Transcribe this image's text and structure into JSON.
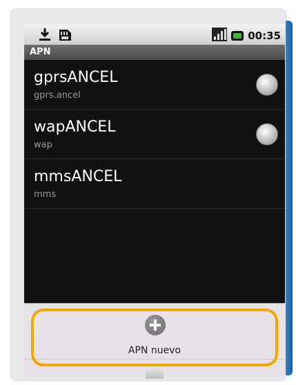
{
  "status_bar": {
    "time": "00:35",
    "icons": [
      "download-icon",
      "sd-card-icon",
      "signal-icon",
      "battery-icon"
    ]
  },
  "title_bar": {
    "title": "APN"
  },
  "apn_list": [
    {
      "name": "gprsANCEL",
      "apn": "gprs.ancel",
      "selectable": true
    },
    {
      "name": "wapANCEL",
      "apn": "wap",
      "selectable": true
    },
    {
      "name": "mmsANCEL",
      "apn": "mms",
      "selectable": false
    }
  ],
  "menu": {
    "new_apn_label": "APN nuevo",
    "icon": "add-icon"
  },
  "colors": {
    "highlight": "#f2a600",
    "frame_edge": "#2d6fb0"
  }
}
